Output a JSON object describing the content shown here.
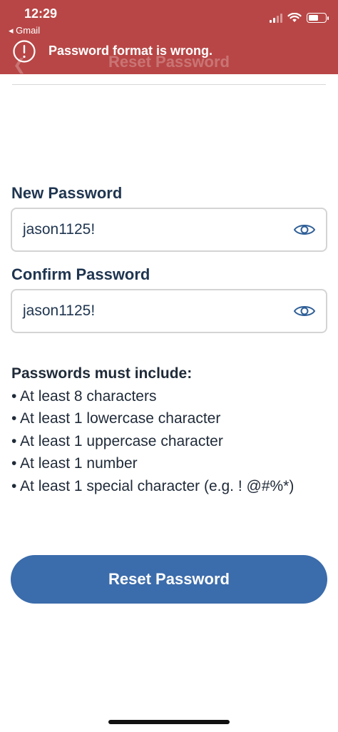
{
  "status_bar": {
    "time": "12:29",
    "back_app": "◂ Gmail",
    "battery_level": 0.6
  },
  "header": {
    "title": "Reset Password",
    "back_icon": "chevron-left-icon"
  },
  "error_banner": {
    "message": "Password format is wrong.",
    "icon": "alert-circle-icon",
    "color": "#b84646"
  },
  "form": {
    "new_password": {
      "label": "New Password",
      "value": "jason1125!",
      "icon": "eye-icon"
    },
    "confirm_password": {
      "label": "Confirm Password",
      "value": "jason1125!",
      "icon": "eye-icon"
    }
  },
  "requirements": {
    "title": "Passwords must include:",
    "items": [
      "• At least 8 characters",
      "• At least 1 lowercase character",
      "• At least 1 uppercase character",
      "• At least 1 number",
      "• At least 1 special character (e.g. ! @#%*)"
    ]
  },
  "reset_button": {
    "label": "Reset Password",
    "color": "#3b6cab"
  }
}
